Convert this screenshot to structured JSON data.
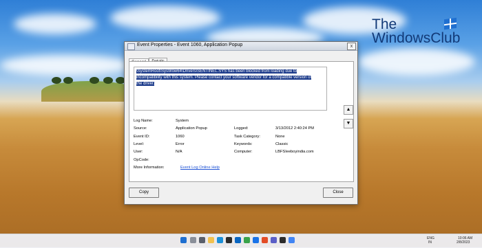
{
  "window": {
    "title": "Event Properties - Event 1060, Application Popup",
    "close_glyph": "x",
    "tabs": [
      {
        "label": "General"
      },
      {
        "label": "Details"
      }
    ],
    "message_lines": [
      "\\SystemRoot\\SysWow64\\Drivers\\SENTINEL.SYS has been blocked from loading due to",
      "incompatibility with this system. Please contact your software vendor for a compatible version of",
      "the driver."
    ],
    "fields": {
      "log_name_label": "Log Name:",
      "log_name_value": "System",
      "source_label": "Source:",
      "source_value": "Application Popup",
      "logged_label": "Logged:",
      "logged_value": "3/13/2012 2:40:24 PM",
      "event_id_label": "Event ID:",
      "event_id_value": "1060",
      "task_category_label": "Task Category:",
      "task_category_value": "None",
      "level_label": "Level:",
      "level_value": "Error",
      "keywords_label": "Keywords:",
      "keywords_value": "Classic",
      "user_label": "User:",
      "user_value": "N/A",
      "computer_label": "Computer:",
      "computer_value": "LBFSIeeboyindia.com",
      "opcode_label": "OpCode:",
      "more_info_label": "More Information:",
      "more_info_link": "Event Log Online Help"
    },
    "copy_label": "Copy",
    "close_label": "Close",
    "scroll_up_glyph": "▲",
    "scroll_down_glyph": "▼"
  },
  "watermark": {
    "line1": "The",
    "line2": "WindowsClub"
  },
  "taskbar": {
    "lang_line1": "ENG",
    "lang_line2": "IN",
    "time": "10:06 AM",
    "date": "2/8/2023"
  },
  "colors": {
    "selection": "#1b3a8a",
    "link": "#1a4fd4",
    "watermark": "#123a78"
  }
}
